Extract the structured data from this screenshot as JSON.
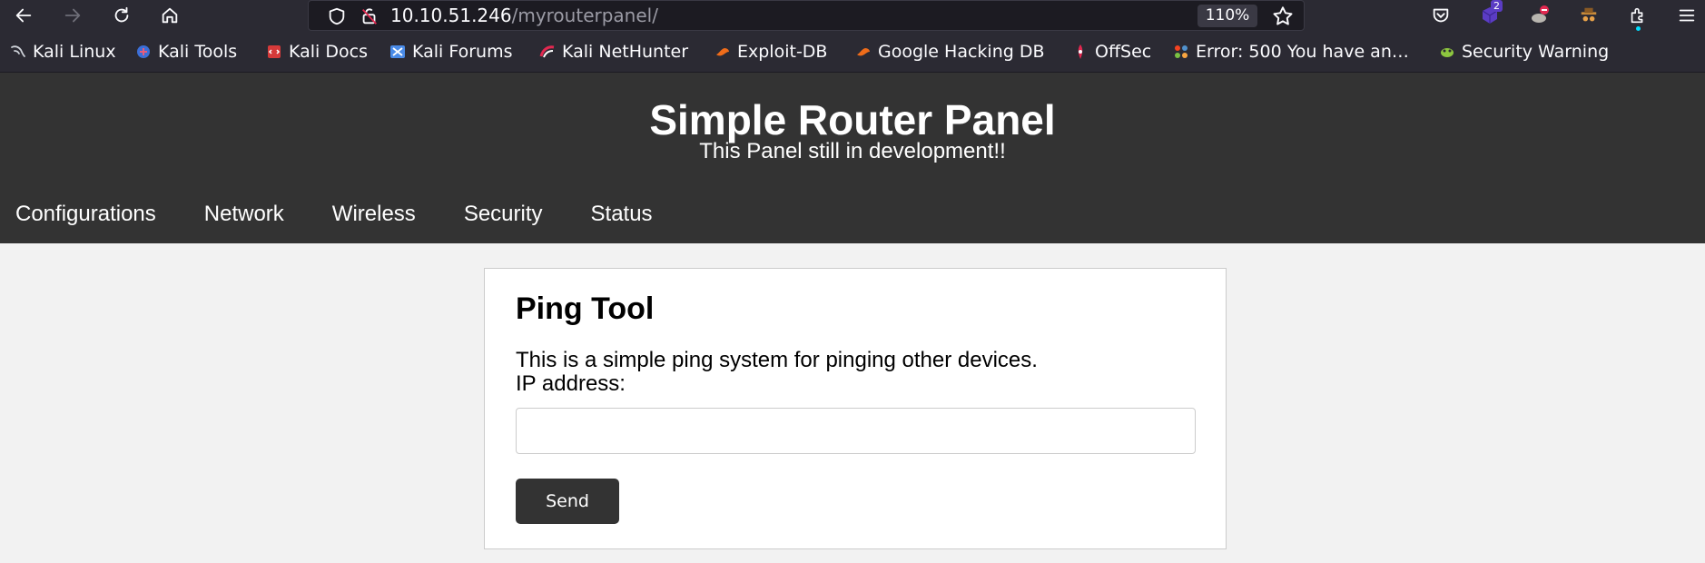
{
  "browser": {
    "url_host": "10.10.51.246",
    "url_path": "/myrouterpanel/",
    "zoom": "110%",
    "extension_badge": "2",
    "icons": [
      "back-icon",
      "forward-icon",
      "reload-icon",
      "home-icon",
      "shield-icon",
      "lock-icon",
      "star-icon",
      "pocket-icon",
      "extension-icon",
      "menu-icon"
    ],
    "accent_color": "#2b2a33"
  },
  "bookmarks": [
    {
      "label": "Kali Linux",
      "icon": "kali-dragon-icon"
    },
    {
      "label": "Kali Tools",
      "icon": "kali-tools-icon"
    },
    {
      "label": "Kali Docs",
      "icon": "kali-docs-icon"
    },
    {
      "label": "Kali Forums",
      "icon": "kali-forums-icon"
    },
    {
      "label": "Kali NetHunter",
      "icon": "nethunter-icon"
    },
    {
      "label": "Exploit-DB",
      "icon": "exploit-db-icon"
    },
    {
      "label": "Google Hacking DB",
      "icon": "ghdb-icon"
    },
    {
      "label": "OffSec",
      "icon": "offsec-icon"
    },
    {
      "label": "Error: 500 You have an…",
      "icon": "joomla-icon"
    },
    {
      "label": "Security Warning",
      "icon": "security-warning-icon"
    }
  ],
  "site": {
    "title": "Simple Router Panel",
    "subtitle": "This Panel still in development!!",
    "menu": [
      "Configurations",
      "Network",
      "Wireless",
      "Security",
      "Status"
    ],
    "header_color": "#333333"
  },
  "ping_tool": {
    "title": "Ping Tool",
    "description": "This is a simple ping system for pinging other devices.",
    "ip_label": "IP address:",
    "ip_value": "",
    "send_label": "Send"
  }
}
